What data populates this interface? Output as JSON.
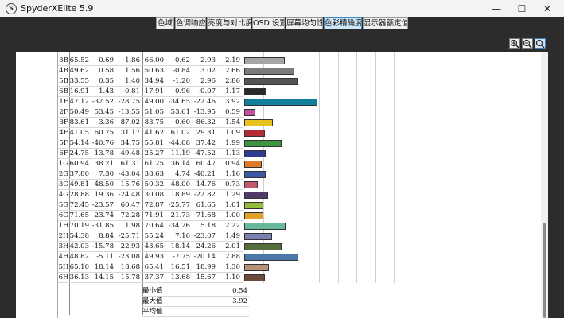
{
  "window": {
    "title": "SpyderXElite 5.9",
    "minimize_symbol": "—",
    "maximize_symbol": "☐",
    "close_symbol": "✕"
  },
  "tabs": [
    {
      "label": "色域",
      "active": false
    },
    {
      "label": "色调响应",
      "active": false
    },
    {
      "label": "亮度与对比度",
      "active": false
    },
    {
      "label": "OSD 设置",
      "active": false
    },
    {
      "label": "屏幕均匀性",
      "active": false
    },
    {
      "label": "色彩精确度",
      "active": true
    },
    {
      "label": "显示器额定值",
      "active": false
    }
  ],
  "toolbar": {
    "zoom_in_icon": "zoom-in-icon",
    "zoom_out_icon": "zoom-out-icon",
    "zoom_fit_icon": "zoom-fit-icon"
  },
  "table": {
    "rows": [
      {
        "id": "3B",
        "v": [
          "65.52",
          "0.69",
          "1.86",
          "66.00",
          "-0.62",
          "2.93",
          "2.19"
        ],
        "color": "#a5a5a5"
      },
      {
        "id": "4B",
        "v": [
          "49.62",
          "0.58",
          "1.56",
          "50.63",
          "-0.84",
          "3.02",
          "2.66"
        ],
        "color": "#7b7b7b"
      },
      {
        "id": "5B",
        "v": [
          "33.55",
          "0.35",
          "1.40",
          "34.94",
          "-1.20",
          "2.96",
          "2.86"
        ],
        "color": "#555555"
      },
      {
        "id": "6B",
        "v": [
          "16.91",
          "1.43",
          "-0.81",
          "17.91",
          "0.96",
          "-0.07",
          "1.17"
        ],
        "color": "#2a2a2a"
      },
      {
        "id": "1F",
        "v": [
          "47.12",
          "-32.52",
          "-28.75",
          "49.00",
          "-34.65",
          "-22.46",
          "3.92"
        ],
        "color": "#127e9e"
      },
      {
        "id": "2F",
        "v": [
          "50.49",
          "53.45",
          "-13.55",
          "51.05",
          "53.61",
          "-13.95",
          "0.59"
        ],
        "color": "#c2529a"
      },
      {
        "id": "3F",
        "v": [
          "83.61",
          "3.36",
          "87.02",
          "83.75",
          "0.60",
          "86.32",
          "1.54"
        ],
        "color": "#e8c31f"
      },
      {
        "id": "4F",
        "v": [
          "41.05",
          "60.75",
          "31.17",
          "41.62",
          "61.02",
          "29.31",
          "1.09"
        ],
        "color": "#b12a34"
      },
      {
        "id": "5F",
        "v": [
          "54.14",
          "-40.76",
          "34.75",
          "55.81",
          "-44.08",
          "37.42",
          "1.99"
        ],
        "color": "#3e9443"
      },
      {
        "id": "6F",
        "v": [
          "24.75",
          "13.78",
          "-49.48",
          "25.27",
          "11.19",
          "-47.52",
          "1.13"
        ],
        "color": "#2f3c92"
      },
      {
        "id": "1G",
        "v": [
          "60.94",
          "38.21",
          "61.31",
          "61.25",
          "36.14",
          "60.47",
          "0.94"
        ],
        "color": "#de7b26"
      },
      {
        "id": "2G",
        "v": [
          "37.80",
          "7.30",
          "-43.04",
          "38.63",
          "4.74",
          "-40.21",
          "1.16"
        ],
        "color": "#3b5aa6"
      },
      {
        "id": "3G",
        "v": [
          "49.81",
          "48.50",
          "15.76",
          "50.32",
          "48.00",
          "14.76",
          "0.73"
        ],
        "color": "#c35a6c"
      },
      {
        "id": "4G",
        "v": [
          "28.88",
          "19.36",
          "-24.48",
          "30.08",
          "18.89",
          "-22.82",
          "1.29"
        ],
        "color": "#4f3a68"
      },
      {
        "id": "5G",
        "v": [
          "72.45",
          "-23.57",
          "60.47",
          "72.87",
          "-25.77",
          "61.65",
          "1.01"
        ],
        "color": "#93bc3b"
      },
      {
        "id": "6G",
        "v": [
          "71.65",
          "23.74",
          "72.28",
          "71.91",
          "21.73",
          "71.68",
          "1.00"
        ],
        "color": "#e1a02a"
      },
      {
        "id": "1H",
        "v": [
          "70.19",
          "-31.85",
          "1.98",
          "70.64",
          "-34.26",
          "5.18",
          "2.22"
        ],
        "color": "#6ab89a"
      },
      {
        "id": "2H",
        "v": [
          "54.38",
          "8.84",
          "-25.71",
          "55.24",
          "7.16",
          "-23.07",
          "1.49"
        ],
        "color": "#7b80b4"
      },
      {
        "id": "3H",
        "v": [
          "42.03",
          "-15.78",
          "22.93",
          "43.65",
          "-18.14",
          "24.26",
          "2.01"
        ],
        "color": "#546d3d"
      },
      {
        "id": "4H",
        "v": [
          "48.82",
          "-5.11",
          "-23.08",
          "49.93",
          "-7.75",
          "-20.14",
          "2.88"
        ],
        "color": "#4a78a8"
      },
      {
        "id": "5H",
        "v": [
          "65.10",
          "18.14",
          "18.68",
          "65.41",
          "16.51",
          "18.99",
          "1.30"
        ],
        "color": "#b8907a"
      },
      {
        "id": "6H",
        "v": [
          "36.13",
          "14.15",
          "15.78",
          "37.37",
          "13.68",
          "15.67",
          "1.10"
        ],
        "color": "#6c4a3c"
      }
    ],
    "stats": [
      {
        "label": "最小值",
        "value": "0.54"
      },
      {
        "label": "最大值",
        "value": "3.92"
      },
      {
        "label": "平均值",
        "value": ""
      }
    ]
  }
}
